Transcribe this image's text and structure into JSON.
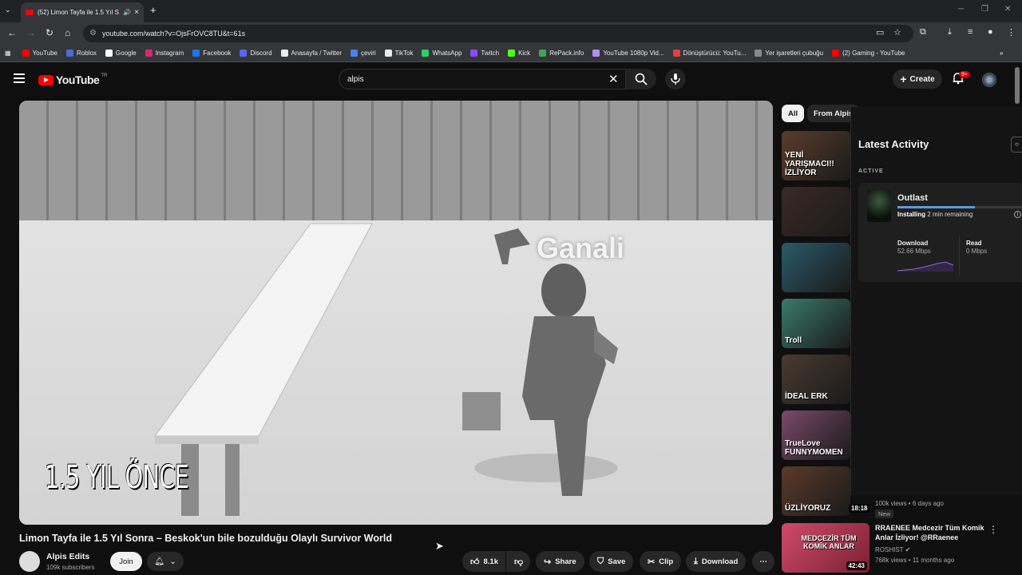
{
  "browser": {
    "tab_title": "(52) Limon Tayfa ile 1.5 Yıl S",
    "tab_list_icon": "chevron-down-icon",
    "url": "youtube.com/watch?v=OjsFrOVC8TU&t=61s",
    "bookmarks": [
      {
        "label": "YouTube",
        "color": "#ff0000"
      },
      {
        "label": "Roblox",
        "color": "#4a6cd4"
      },
      {
        "label": "Google",
        "color": "#ffffff"
      },
      {
        "label": "Instagram",
        "color": "#d62976"
      },
      {
        "label": "Facebook",
        "color": "#1877f2"
      },
      {
        "label": "Discord",
        "color": "#5865f2"
      },
      {
        "label": "Anasayfa / Twitter",
        "color": "#e8eaed"
      },
      {
        "label": "çeviri",
        "color": "#4285f4"
      },
      {
        "label": "TikTok",
        "color": "#e8eaed"
      },
      {
        "label": "WhatsApp",
        "color": "#25d366"
      },
      {
        "label": "Twitch",
        "color": "#9146ff"
      },
      {
        "label": "Kick",
        "color": "#53fc18"
      },
      {
        "label": "RePack.info",
        "color": "#3ea64a"
      },
      {
        "label": "YouTube 1080p Vid...",
        "color": "#b38cff"
      },
      {
        "label": "Dönüştürücü: YouTu...",
        "color": "#e04040"
      },
      {
        "label": "Yer işaretleri çubuğu",
        "color": "#888888"
      },
      {
        "label": "(2) Gaming - YouTube",
        "color": "#ff0000"
      }
    ],
    "overflow_label": "»"
  },
  "header": {
    "logo_text": "YouTube",
    "country": "TR",
    "search_value": "alpis",
    "create_label": "Create",
    "notif_badge": "9+"
  },
  "video": {
    "overlay_text": "1.5 YIL ÖNCE",
    "player_name_tag": "Ganali",
    "title": "Limon Tayfa ile 1.5 Yıl Sonra – Beskok'un bile bozulduğu Olaylı Survivor World",
    "channel_name": "Alpis Edits",
    "subscribers": "109k subscribers",
    "join_label": "Join",
    "like_count": "8.1k",
    "share_label": "Share",
    "save_label": "Save",
    "clip_label": "Clip",
    "download_label": "Download"
  },
  "sidebar": {
    "chips": [
      "All",
      "From Alpis"
    ],
    "thumbs": [
      {
        "text": "YENİ YARIŞMACI!! İZLİYOR",
        "bg": "#5a3d2b"
      },
      {
        "text": "",
        "bg": "#3a2a24"
      },
      {
        "text": "",
        "bg": "#2a5a6a"
      },
      {
        "text": "Troll",
        "bg": "#3a7a6a"
      },
      {
        "text": "İDEAL ERK",
        "bg": "#4a3a30"
      },
      {
        "text": "TrueLove FUNNYMOMEN",
        "bg": "#7a4a6a"
      },
      {
        "text": "ÜZLİYORUZ",
        "bg": "#5a3a2a"
      }
    ],
    "thumb7_duration": "18:18",
    "rec1_meta": "100k views • 6 days ago",
    "rec1_badge": "New",
    "rec2": {
      "title": "RRAENEE Medcezir Tüm Komik Anlar İzliyor! @RRaenee",
      "channel": "ROSHIST",
      "meta": "768k views • 11 months ago",
      "duration": "42:43",
      "thumb_text": "MEDCEZİR TÜM KOMİK ANLAR"
    }
  },
  "activity_panel": {
    "title": "Latest Activity",
    "section": "ACTIVE",
    "game": "Outlast",
    "status": "Installing",
    "remaining": "2 min remaining",
    "progress": 0.62,
    "download_label": "Download",
    "download_value": "52.66 Mbps",
    "read_label": "Read",
    "read_value": "0 Mbps"
  }
}
